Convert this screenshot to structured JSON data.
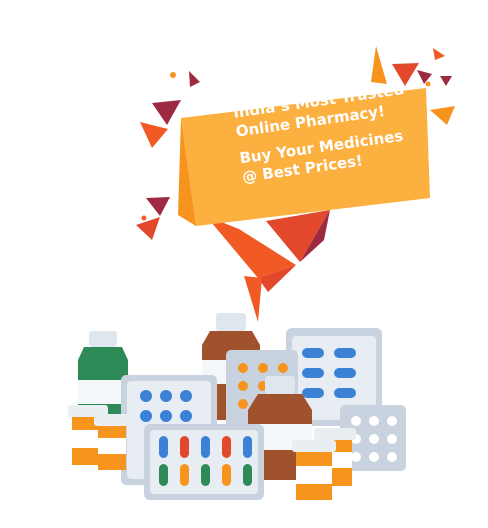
{
  "banner": {
    "line1": "India’s Most Trusted",
    "line2": "Online Pharmacy!",
    "line3": "Buy Your Medicines",
    "line4": "@ Best Prices!"
  },
  "colors": {
    "banner_main": "#fbb040",
    "banner_shade": "#f7941d",
    "ribbon_dark": "#e2482b",
    "ribbon_red": "#f15a24",
    "confetti_maroon": "#9e2a42",
    "green_bottle": "#2e8b57",
    "amber_bottle": "#a0522d",
    "orange_bottle": "#f7941d",
    "blister_blue": "#3b82d6",
    "blister_white": "#e8edf4"
  }
}
